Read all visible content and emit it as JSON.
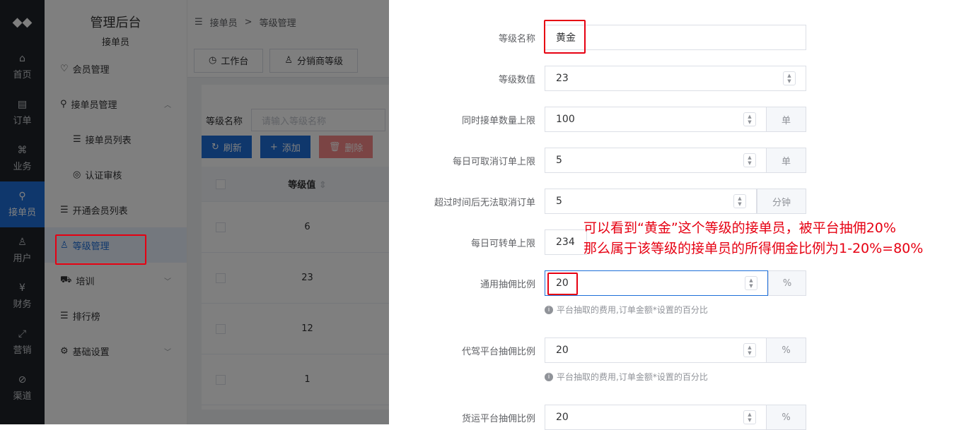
{
  "rail": {
    "items": [
      {
        "label": "首页",
        "icon": "home-icon",
        "glyph": "⌂"
      },
      {
        "label": "订单",
        "icon": "order-icon",
        "glyph": "▤"
      },
      {
        "label": "业务",
        "icon": "grid-icon",
        "glyph": "⌘"
      },
      {
        "label": "接单员",
        "icon": "bike-icon",
        "glyph": "⚲"
      },
      {
        "label": "用户",
        "icon": "user-icon",
        "glyph": "♙"
      },
      {
        "label": "财务",
        "icon": "money-icon",
        "glyph": "¥"
      },
      {
        "label": "营销",
        "icon": "chart-icon",
        "glyph": "⤢"
      },
      {
        "label": "渠道",
        "icon": "channel-icon",
        "glyph": "⊘"
      }
    ]
  },
  "sidebar": {
    "title": "管理后台",
    "subtitle": "接单员",
    "items": [
      {
        "label": "会员管理",
        "glyph": "♡"
      },
      {
        "label": "接单员管理",
        "glyph": "⚲"
      },
      {
        "label": "接单员列表",
        "glyph": "☰"
      },
      {
        "label": "认证审核",
        "glyph": "◎"
      },
      {
        "label": "开通会员列表",
        "glyph": "☰"
      },
      {
        "label": "等级管理",
        "glyph": "♙"
      },
      {
        "label": "培训",
        "glyph": "⛟"
      },
      {
        "label": "排行榜",
        "glyph": "☰"
      },
      {
        "label": "基础设置",
        "glyph": "⚙"
      }
    ]
  },
  "breadcrumb": {
    "toggle": "☰",
    "first": "接单员",
    "sep": ">",
    "current": "等级管理"
  },
  "tabs": [
    {
      "label": "工作台",
      "glyph": "◷"
    },
    {
      "label": "分销商等级",
      "glyph": "♙"
    }
  ],
  "filter": {
    "label": "等级名称",
    "placeholder": "请输入等级名称"
  },
  "buttons": {
    "refresh": "刷新",
    "add": "添加",
    "delete": "删除"
  },
  "table": {
    "header": "等级值",
    "sort_glyph": "⇕",
    "rows": [
      "6",
      "23",
      "12",
      "1"
    ]
  },
  "form": {
    "fields": [
      {
        "label": "等级名称",
        "value": "黄金"
      },
      {
        "label": "等级数值",
        "value": "23"
      },
      {
        "label": "同时接单数量上限",
        "value": "100",
        "unit": "单"
      },
      {
        "label": "每日可取消订单上限",
        "value": "5",
        "unit": "单"
      },
      {
        "label": "超过时间后无法取消订单",
        "value": "5",
        "unit": "分钟"
      },
      {
        "label": "每日可转单上限",
        "value": "234"
      },
      {
        "label": "通用抽佣比例",
        "value": "20",
        "unit": "%",
        "hint": "平台抽取的费用,订单金额*设置的百分比"
      },
      {
        "label": "代驾平台抽佣比例",
        "value": "20",
        "unit": "%",
        "hint": "平台抽取的费用,订单金额*设置的百分比"
      },
      {
        "label": "货运平台抽佣比例",
        "value": "20",
        "unit": "%"
      }
    ]
  },
  "annotation": {
    "line1": "可以看到“黄金”这个等级的接单员，被平台抽佣20%",
    "line2": "那么属于该等级的接单员的所得佣金比例为1-20%=80%"
  },
  "colors": {
    "accent": "#1e6fd9",
    "annotation": "#e60012",
    "rail_bg": "#1f2329"
  }
}
